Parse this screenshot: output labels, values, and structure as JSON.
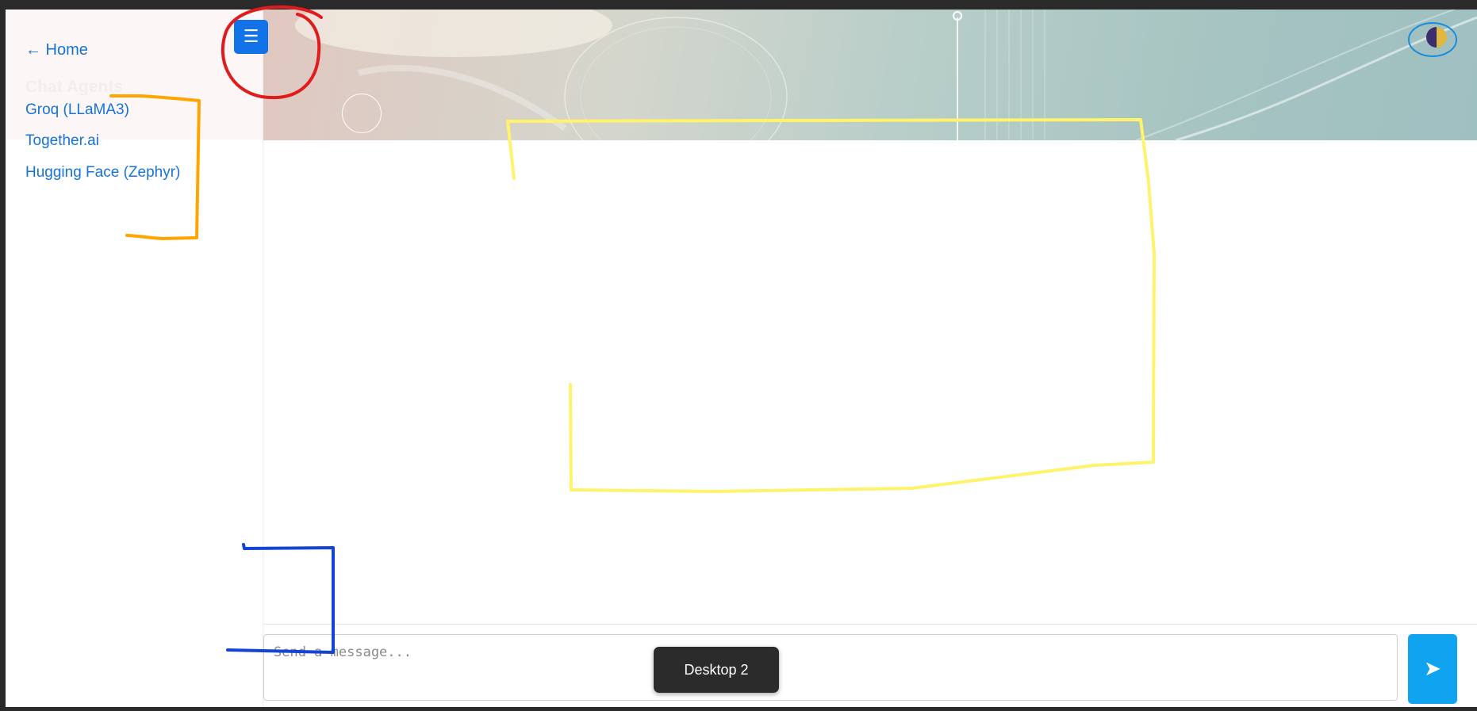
{
  "sidebar": {
    "home_link": "← Home",
    "section_title": "Chat Agents",
    "agents": [
      {
        "label": "Groq (LLaMA3)"
      },
      {
        "label": "Together.ai"
      },
      {
        "label": "Hugging Face (Zephyr)"
      }
    ]
  },
  "toolbar": {
    "menu_icon": "☰"
  },
  "input": {
    "placeholder": "Send a message...",
    "send_icon": "➤"
  },
  "taskbar_tooltip": {
    "label": "Desktop 2"
  },
  "colors": {
    "accent": "#1273e8",
    "link": "#1673d9",
    "send": "#0fa3f0",
    "annotation_red": "#e01b1b",
    "annotation_orange": "#ffa500",
    "annotation_yellow": "#fff36b",
    "annotation_blue": "#1244d6"
  }
}
